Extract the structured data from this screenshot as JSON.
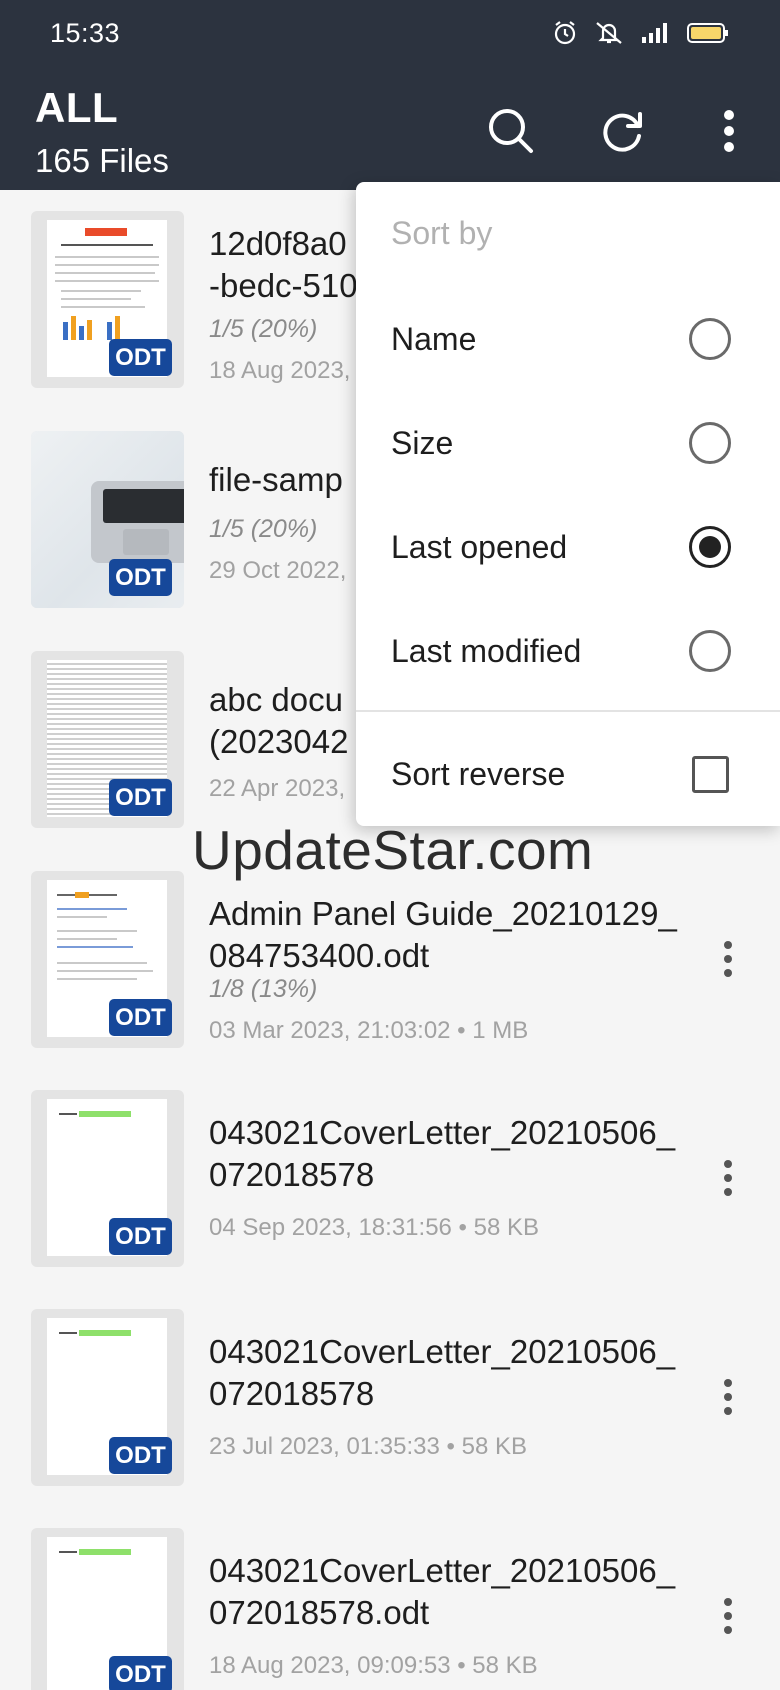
{
  "status_bar": {
    "time": "15:33"
  },
  "header": {
    "title": "ALL",
    "subtitle": "165 Files"
  },
  "files": [
    {
      "name": "12d0f8a0",
      "name2": "-bedc-510",
      "progress": "1/5 (20%)",
      "meta": "18 Aug 2023,"
    },
    {
      "name": "file-samp",
      "progress": "1/5 (20%)",
      "meta": "29 Oct 2022,"
    },
    {
      "name": "abc docu",
      "name2": "(2023042",
      "meta": "22 Apr 2023,"
    },
    {
      "name": "Admin Panel Guide_20210129_084753400.odt",
      "progress": "1/8 (13%)",
      "meta": "03 Mar 2023, 21:03:02  •  1 MB"
    },
    {
      "name": "043021CoverLetter_20210506_072018578",
      "meta": "04 Sep 2023, 18:31:56  •  58 KB"
    },
    {
      "name": "043021CoverLetter_20210506_072018578",
      "meta": "23 Jul 2023, 01:35:33  •  58 KB"
    },
    {
      "name": "043021CoverLetter_20210506_072018578.odt",
      "meta": "18 Aug 2023, 09:09:53  •  58 KB"
    }
  ],
  "badge": "ODT",
  "watermark": "UpdateStar.com",
  "sort_menu": {
    "header": "Sort by",
    "options": [
      {
        "label": "Name",
        "selected": false
      },
      {
        "label": "Size",
        "selected": false
      },
      {
        "label": "Last opened",
        "selected": true
      },
      {
        "label": "Last modified",
        "selected": false
      }
    ],
    "reverse_label": "Sort reverse",
    "reverse_checked": false
  }
}
